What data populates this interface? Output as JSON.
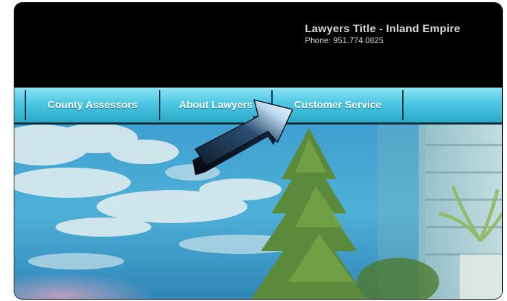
{
  "header": {
    "company_name": "Lawyers Title - Inland Empire",
    "phone": "Phone: 951.774.0825"
  },
  "nav": {
    "items": [
      {
        "label": "County Assessors"
      },
      {
        "label": "About Lawyers"
      },
      {
        "label": "Customer Service"
      }
    ]
  },
  "icons": {
    "arrow": "pointer-arrow-icon"
  },
  "colors": {
    "header_bg": "#000000",
    "nav_top": "#8ee4f4",
    "nav_bottom": "#2aa9c8",
    "nav_text": "#ffffff",
    "company_text": "#d8d8d8"
  }
}
